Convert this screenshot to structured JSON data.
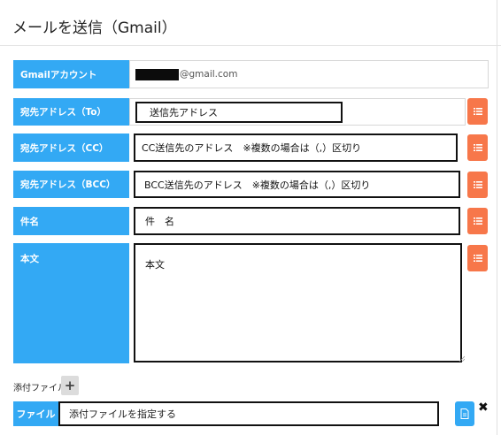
{
  "header": {
    "title": "メールを送信（Gmail）"
  },
  "form": {
    "account": {
      "label": "Gmailアカウント",
      "suffix": "@gmail.com"
    },
    "to": {
      "label": "宛先アドレス（To）",
      "value": "送信先アドレス"
    },
    "cc": {
      "label": "宛先アドレス（CC）",
      "value": "CC送信先のアドレス　※複数の場合は（,）区切り"
    },
    "bcc": {
      "label": "宛先アドレス（BCC）",
      "value": "BCC送信先のアドレス　※複数の場合は（,）区切り"
    },
    "subject": {
      "label": "件名",
      "value": "件　名"
    },
    "body": {
      "label": "本文",
      "value": "本文"
    }
  },
  "attachments": {
    "label": "添付ファイル",
    "add_symbol": "+",
    "file_button": "ファイル",
    "file_placeholder": "添付ファイルを指定する",
    "remove_symbol": "✖"
  },
  "colors": {
    "label_bg": "#33a9f4",
    "icon_button": "#f7774a",
    "file_icon_bg": "#33a9f4"
  },
  "icons": [
    "list-icon",
    "plus-icon",
    "document-icon",
    "close-icon",
    "resize-handle-icon"
  ]
}
